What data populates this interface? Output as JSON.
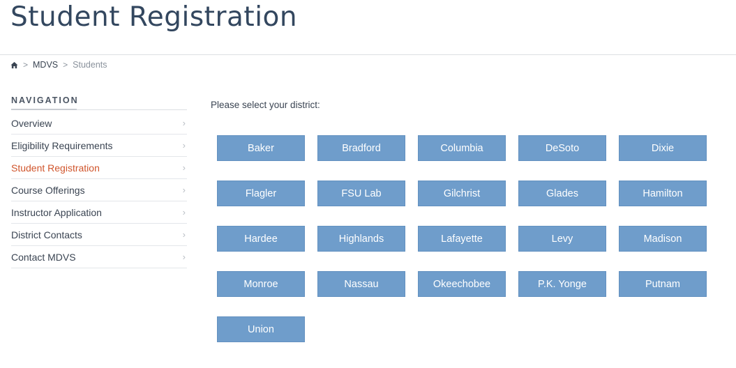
{
  "page": {
    "title": "Student Registration"
  },
  "breadcrumb": {
    "home_icon": "home-icon",
    "separator": ">",
    "items": [
      {
        "label": "MDVS"
      },
      {
        "label": "Students"
      }
    ]
  },
  "navigation": {
    "heading": "NAVIGATION",
    "chevron_icon": "chevron-right-icon",
    "active_color": "#d0552c",
    "items": [
      {
        "label": "Overview"
      },
      {
        "label": "Eligibility Requirements"
      },
      {
        "label": "Student Registration",
        "active": true
      },
      {
        "label": "Course Offerings"
      },
      {
        "label": "Instructor Application"
      },
      {
        "label": "District Contacts"
      },
      {
        "label": "Contact MDVS"
      }
    ]
  },
  "main": {
    "prompt": "Please select your district:",
    "button_color": "#6f9dcb",
    "districts": [
      "Baker",
      "Bradford",
      "Columbia",
      "DeSoto",
      "Dixie",
      "Flagler",
      "FSU Lab",
      "Gilchrist",
      "Glades",
      "Hamilton",
      "Hardee",
      "Highlands",
      "Lafayette",
      "Levy",
      "Madison",
      "Monroe",
      "Nassau",
      "Okeechobee",
      "P.K. Yonge",
      "Putnam",
      "Union"
    ]
  }
}
